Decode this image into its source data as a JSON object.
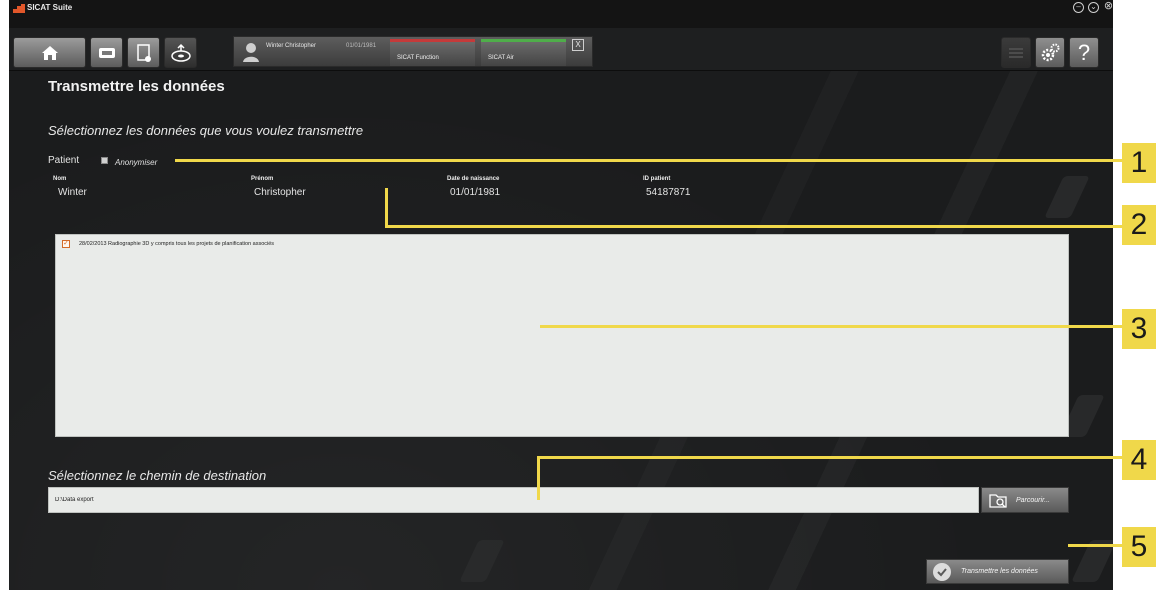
{
  "app": {
    "title": "SICAT Suite"
  },
  "patient_card": {
    "name": "Winter  Christopher",
    "dob": "01/01/1981",
    "tabs": [
      {
        "label": "SICAT Function",
        "color": "#c53a3a"
      },
      {
        "label": "SICAT Air",
        "color": "#4fae4a"
      }
    ],
    "close_label": "X"
  },
  "page": {
    "title": "Transmettre les données",
    "subtitle": "Sélectionnez les données que vous voulez transmettre",
    "patient_label": "Patient",
    "anonymize_label": "Anonymiser",
    "fields": [
      {
        "header": "Nom",
        "value": "Winter"
      },
      {
        "header": "Prénom",
        "value": "Christopher"
      },
      {
        "header": "Date de naissance",
        "value": "01/01/1981"
      },
      {
        "header": "ID patient",
        "value": "54187871"
      }
    ],
    "data_items": [
      {
        "text": "28/02/2013  Radiographie 3D  y compris tous les projets de planification associés",
        "checked": true
      }
    ],
    "destination_title": "Sélectionnez le chemin de destination",
    "destination_value": "D:\\Data export",
    "browse_label": "Parcourir...",
    "transmit_label": "Transmettre les données"
  },
  "callouts": [
    "1",
    "2",
    "3",
    "4",
    "5"
  ],
  "colors": {
    "accent": "#f0d84a",
    "checkbox": "#d46b2a",
    "background": "#1b1c1d"
  }
}
